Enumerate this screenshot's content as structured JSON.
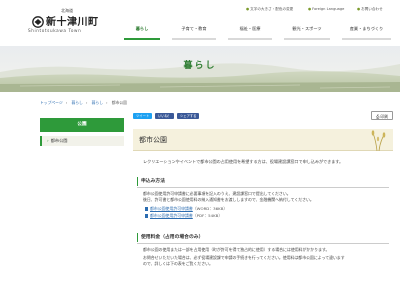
{
  "header": {
    "prefecture": "北海道",
    "town_name": "新十津川町",
    "town_roman": "Shintotsukawa Town",
    "utility_links": [
      "文字の大きさ・配色の変更",
      "Foreign Language",
      "お問い合わせ"
    ]
  },
  "global_nav": [
    {
      "label": "暮らし",
      "active": true
    },
    {
      "label": "子育て・教育",
      "active": false
    },
    {
      "label": "福祉・医療",
      "active": false
    },
    {
      "label": "観光・スポーツ",
      "active": false
    },
    {
      "label": "産業・まちづくり",
      "active": false
    }
  ],
  "hero": {
    "title": "暮らし"
  },
  "breadcrumb": [
    "トップページ",
    "暮らし",
    "暮らし",
    "都市公園"
  ],
  "sidebar": {
    "title": "公園",
    "items": [
      {
        "label": "都市公園"
      }
    ]
  },
  "toolbar": {
    "sns": [
      "ツイート",
      "いいね！",
      "シェアする"
    ],
    "print_label": "印刷"
  },
  "page": {
    "title": "都市公園",
    "intro": "レクリエーションやイベントで都市公園の占用使用を希望する方は、役場建設課窓口で申し込みができます。",
    "section1": {
      "heading": "申込み方法",
      "lines": [
        "都市公園使用許可申請書に必要事項を記入のうえ、建設課窓口で提出してください。",
        "後日、許可書と都市公園使用料の納入通知書をお渡ししますので、金融機関へ納付してください。"
      ],
      "downloads": [
        {
          "label": "都市公園使用許可申請書",
          "ext": "（WORD：36KB）"
        },
        {
          "label": "都市公園使用許可申請書",
          "ext": "（PDF：54KB）"
        }
      ]
    },
    "section2": {
      "heading": "使用料金（占用の場合のみ）",
      "lines": [
        "都市公園の使用または一部を占用使用（町が許可を得て独占的に使用）する場合には使用料がかかります。",
        "お問合せいただいた場合は、必ず役場建設課で申請の手続きを行ってください。使用料は都市公園によって違います",
        "ので、詳しくは下の表をご覧ください。"
      ]
    }
  },
  "colors": {
    "accent": "#2e9a3a",
    "link": "#2b6cb0",
    "title_bg": "#f5f1dd"
  }
}
